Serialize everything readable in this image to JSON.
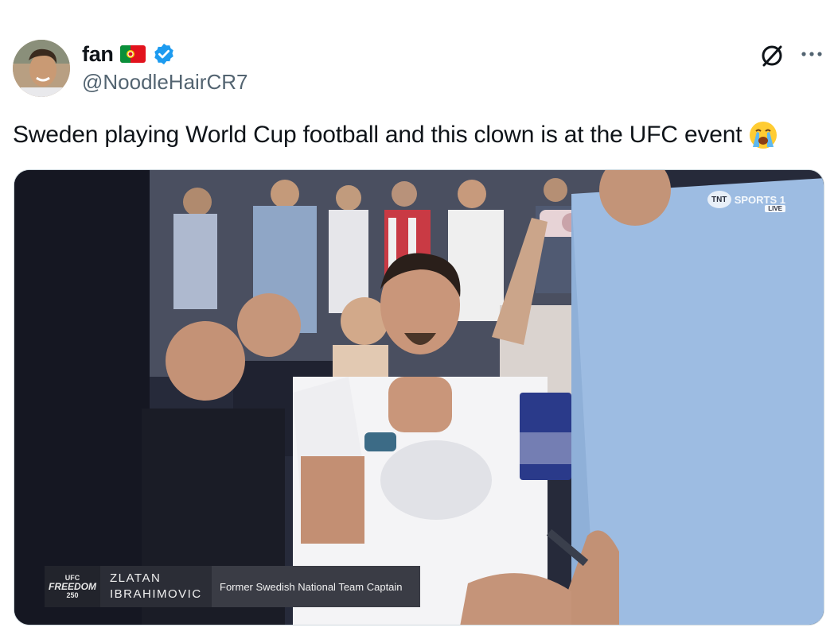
{
  "author": {
    "display_name": "fan",
    "handle": "@NoodleHairCR7"
  },
  "icons": {
    "flag": "portugal-flag-icon",
    "verified": "verified-badge-icon",
    "grok": "grok-icon",
    "more": "more-options-icon",
    "emoji": "loudly-crying-face-emoji"
  },
  "tweet": {
    "text": "Sweden playing World Cup football and this clown is at the UFC event"
  },
  "media": {
    "broadcaster": "SPORTS 1",
    "broadcaster_logo": "TNT",
    "live_label": "LIVE",
    "lower_third": {
      "event_logo_top": "UFC",
      "event_logo_main": "FREEDOM",
      "event_logo_bottom": "250",
      "name_line1": "ZLATAN",
      "name_line2": "IBRAHIMOVIC",
      "role": "Former Swedish National Team Captain"
    }
  },
  "colors": {
    "verified_blue": "#1d9bf0",
    "secondary_text": "#536471",
    "primary_text": "#0f1419"
  }
}
